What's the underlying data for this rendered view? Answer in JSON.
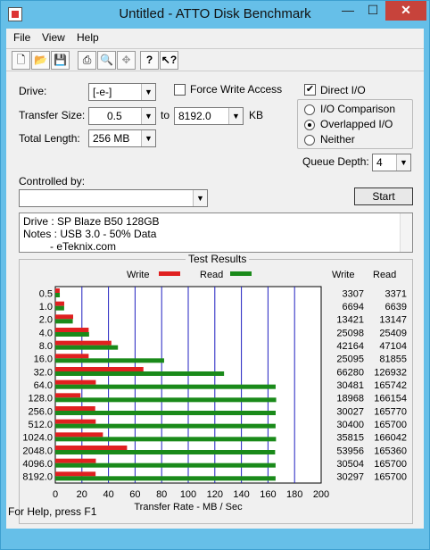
{
  "window": {
    "title": "Untitled - ATTO Disk Benchmark",
    "controls": {
      "minimize": "—",
      "maximize": "☐",
      "close": "✕"
    }
  },
  "menu": {
    "items": [
      "File",
      "View",
      "Help"
    ]
  },
  "toolbar": {
    "buttons": [
      "new-icon",
      "open-icon",
      "save-icon",
      "print-icon",
      "print-preview-icon",
      "move-icon",
      "help-icon",
      "context-help-icon"
    ]
  },
  "settings": {
    "drive_label": "Drive:",
    "drive_value": "[-e-]",
    "force_write_label": "Force Write Access",
    "force_write_checked": false,
    "direct_io_label": "Direct I/O",
    "direct_io_checked": true,
    "transfer_size_label": "Transfer Size:",
    "transfer_from": "0.5",
    "to_label": "to",
    "transfer_to": "8192.0",
    "kb_label": "KB",
    "total_length_label": "Total Length:",
    "total_length_value": "256 MB",
    "io_options": [
      {
        "label": "I/O Comparison",
        "selected": false
      },
      {
        "label": "Overlapped I/O",
        "selected": true
      },
      {
        "label": "Neither",
        "selected": false
      }
    ],
    "queue_depth_label": "Queue Depth:",
    "queue_depth_value": "4",
    "controlled_by_label": "Controlled by:",
    "controlled_by_value": "",
    "start_label": "Start"
  },
  "notes": {
    "lines": [
      "Drive : SP Blaze B50 128GB",
      "Notes : USB 3.0 - 50% Data",
      "         - eTeknix.com"
    ]
  },
  "chart_data": {
    "type": "bar",
    "orientation": "horizontal",
    "title": "Test Results",
    "xlabel": "Transfer Rate - MB / Sec",
    "xlim": [
      0,
      200
    ],
    "xticks": [
      0,
      20,
      40,
      60,
      80,
      100,
      120,
      140,
      160,
      180,
      200
    ],
    "categories": [
      "0.5",
      "1.0",
      "2.0",
      "4.0",
      "8.0",
      "16.0",
      "32.0",
      "64.0",
      "128.0",
      "256.0",
      "512.0",
      "1024.0",
      "2048.0",
      "4096.0",
      "8192.0"
    ],
    "series": [
      {
        "name": "Write",
        "color": "#e02020",
        "values": [
          3.307,
          6.694,
          13.421,
          25.098,
          42.164,
          25.095,
          66.28,
          30.481,
          18.968,
          30.027,
          30.4,
          35.815,
          53.956,
          30.504,
          30.297
        ]
      },
      {
        "name": "Read",
        "color": "#1a8a1a",
        "values": [
          3.371,
          6.639,
          13.147,
          25.409,
          47.104,
          81.855,
          126.932,
          165.742,
          166.154,
          165.77,
          165.7,
          166.042,
          165.36,
          165.7,
          165.7
        ]
      }
    ],
    "table": {
      "headers": [
        "Write",
        "Read"
      ],
      "write": [
        "3307",
        "6694",
        "13421",
        "25098",
        "42164",
        "25095",
        "66280",
        "30481",
        "18968",
        "30027",
        "30400",
        "35815",
        "53956",
        "30504",
        "30297"
      ],
      "read": [
        "3371",
        "6639",
        "13147",
        "25409",
        "47104",
        "81855",
        "126932",
        "165742",
        "166154",
        "165770",
        "165700",
        "166042",
        "165360",
        "165700",
        "165700"
      ]
    },
    "gridline_color": "#2020c0"
  },
  "status": {
    "text": "For Help, press F1"
  }
}
